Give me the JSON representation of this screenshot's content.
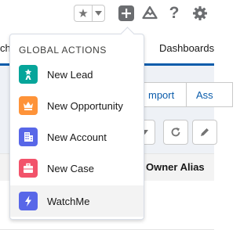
{
  "header": {
    "favorites": {
      "star_icon": "star-icon",
      "chevron_icon": "chevron-down-icon"
    },
    "global_actions_icon": "plus-icon",
    "trailhead_icon": "trailhead-icon",
    "help_label": "?",
    "setup_icon": "gear-icon"
  },
  "nav": {
    "partial_left": "ch",
    "dashboards": "Dashboards"
  },
  "page": {
    "import_button": "mport",
    "assign_button": "Ass",
    "owner_alias_header": "Owner Alias"
  },
  "dropdown": {
    "title": "GLOBAL ACTIONS",
    "items": [
      {
        "label": "New Lead",
        "icon": "lead-icon",
        "color": "#06a59a"
      },
      {
        "label": "New Opportunity",
        "icon": "crown-icon",
        "color": "#fe9339"
      },
      {
        "label": "New Account",
        "icon": "building-icon",
        "color": "#5867e8"
      },
      {
        "label": "New Case",
        "icon": "briefcase-icon",
        "color": "#f2536b"
      },
      {
        "label": "WatchMe",
        "icon": "lightning-icon",
        "color": "#5867e8"
      }
    ]
  },
  "colors": {
    "brand_blue": "#0b5cab",
    "header_icon_gray": "#6b6d70"
  }
}
